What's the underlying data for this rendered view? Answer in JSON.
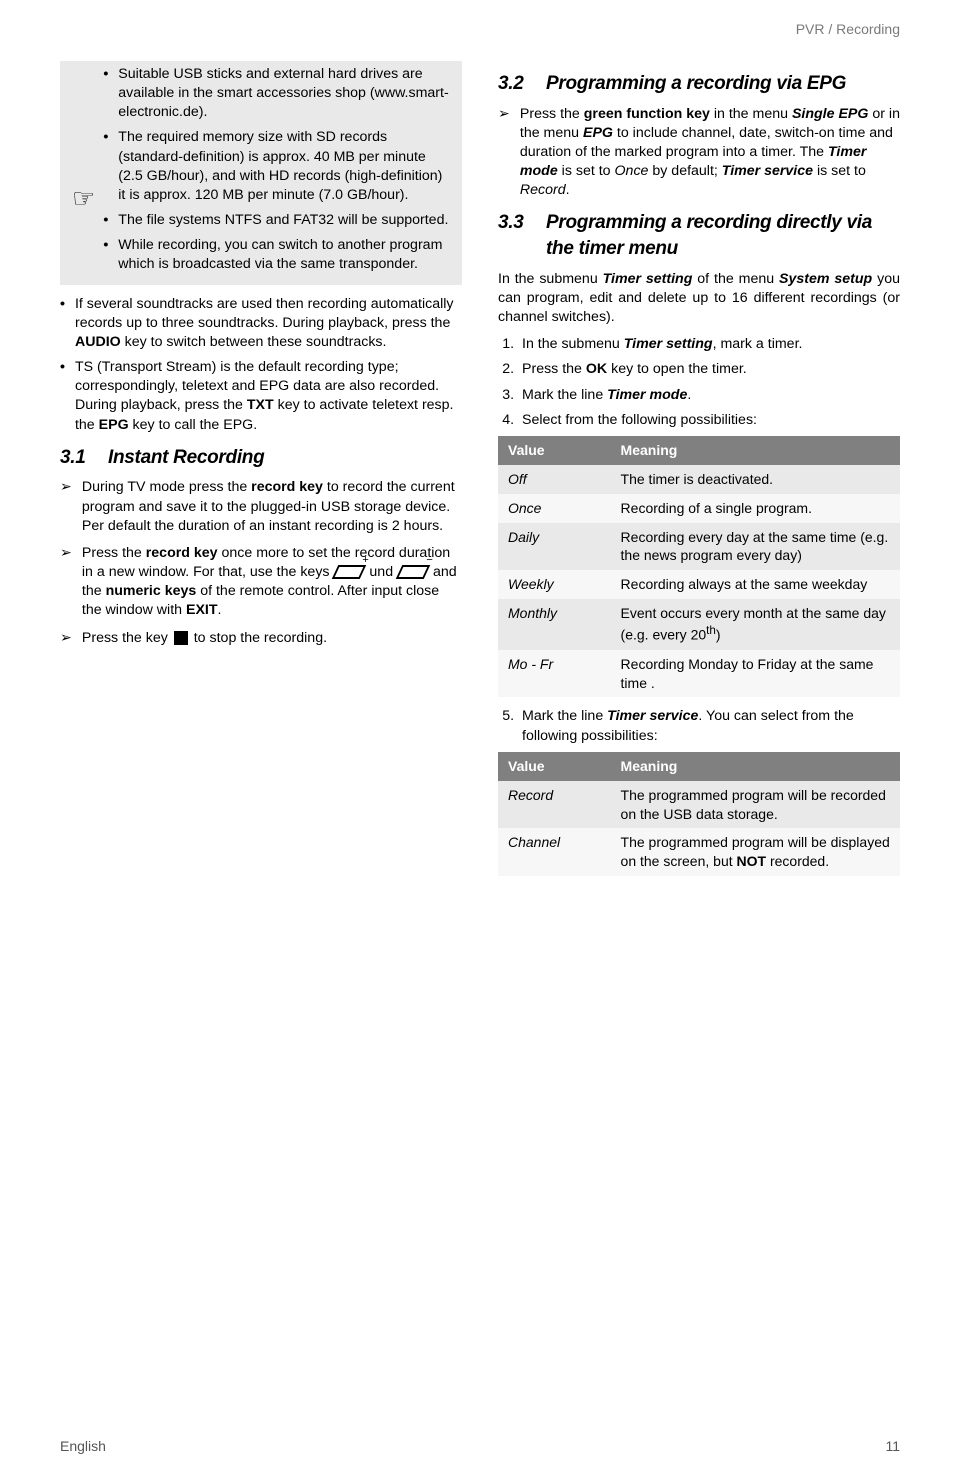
{
  "breadcrumb": "PVR / Recording",
  "callout": {
    "b1_a": "Suitable USB sticks and external hard drives are available in the smart accessories shop (",
    "b1_link": "www.smart-electronic.de",
    "b1_b": ").",
    "b2_a": "The required memory size with SD records (standard-definition) is approx. 40 MB per minute (2.5 GB/hour), and with HD records (high-definition) it is approx. 120 MB per minute (7.0 GB/hour).",
    "b3": "The file systems NTFS and FAT32 will be supported.",
    "b4": "While recording, you can switch to another program which is broadcasted via the same transponder."
  },
  "left_bullets": {
    "s1_a": "If several soundtracks are used then recording automatically records up to three soundtracks. During playback, press the ",
    "s1_key": "AUDIO",
    "s1_b": " key to switch between these soundtracks.",
    "s2_a": "TS (Transport Stream) is the default recording type; correspondingly, teletext and EPG data are also recorded. During playback, press the ",
    "s2_k1": "TXT",
    "s2_b": " key to activate teletext resp. the ",
    "s2_k2": "EPG",
    "s2_c": " key to call the EPG."
  },
  "sec31": {
    "num": "3.1",
    "title": "Instant Recording"
  },
  "sec31_items": {
    "c1_a": "During TV mode press the ",
    "c1_k": "record key",
    "c1_b": " to record the current program and save it to the plugged-in USB storage device. Per default the duration of an instant recording is 2 hours.",
    "c2_a": "Press the ",
    "c2_k": "record key",
    "c2_b": " once more to set the record duration in a new window. For that, use the keys ",
    "c2_mid": " und ",
    "c2_c": " and the ",
    "c2_k2": "numeric keys",
    "c2_d": " of the remote control. After input close the window with ",
    "c2_k3": "EXIT",
    "c2_e": ".",
    "c3_a": "Press the key ",
    "c3_b": " to stop the recording."
  },
  "sec32": {
    "num": "3.2",
    "title": "Programming a recording via EPG"
  },
  "sec32_item": {
    "a": "Press the ",
    "k1": "green function key",
    "b": " in the menu ",
    "i1": "Single EPG",
    "c": " or in the menu ",
    "i2": "EPG",
    "d": " to include channel, date, switch-on time and duration of the marked program into a timer. The ",
    "i3": "Timer mode",
    "e": " is set to ",
    "i4": "Once",
    "f": " by default; ",
    "i5": "Timer service",
    "g": " is set to ",
    "i6": "Record",
    "h": "."
  },
  "sec33": {
    "num": "3.3",
    "title": "Programming a recording directly via the timer menu"
  },
  "sec33_intro": {
    "a": "In the submenu ",
    "i1": "Timer setting",
    "b": " of the menu ",
    "i2": "System setup",
    "c": " you can program, edit and delete up to 16 different recordings (or channel switches)."
  },
  "sec33_steps": {
    "s1_a": "In the submenu ",
    "s1_i": "Timer setting",
    "s1_b": ", mark a timer.",
    "s2_a": "Press the ",
    "s2_k": "OK",
    "s2_b": " key to open the timer.",
    "s3_a": "Mark the line ",
    "s3_i": "Timer mode",
    "s3_b": ".",
    "s4": "Select from the following possibilities:"
  },
  "table1": {
    "h1": "Value",
    "h2": "Meaning",
    "rows": [
      {
        "v": "Off",
        "m": "The timer is deactivated."
      },
      {
        "v": "Once",
        "m": "Recording of a single program."
      },
      {
        "v": "Daily",
        "m": "Recording every day at the same time (e.g. the news program every day)"
      },
      {
        "v": "Weekly",
        "m": "Recording always at the same weekday"
      },
      {
        "v": "Monthly",
        "m_a": "Event occurs every month at the same day (e.g. every 20",
        "sup": "th",
        "m_b": ")"
      },
      {
        "v": "Mo - Fr",
        "m": "Recording Monday to Friday at the same time ."
      }
    ]
  },
  "sec33_step5": {
    "a": "Mark the line ",
    "i": "Timer service",
    "b": ". You can select from the following possibilities:"
  },
  "table2": {
    "h1": "Value",
    "h2": "Meaning",
    "rows": [
      {
        "v": "Record",
        "m": "The programmed program will be recorded on the USB data storage."
      },
      {
        "v": "Channel",
        "m_a": "The programmed program will be displayed on the screen, but ",
        "b": "NOT",
        "m_b": " recorded."
      }
    ]
  },
  "footer": {
    "left": "English",
    "right": "11"
  }
}
